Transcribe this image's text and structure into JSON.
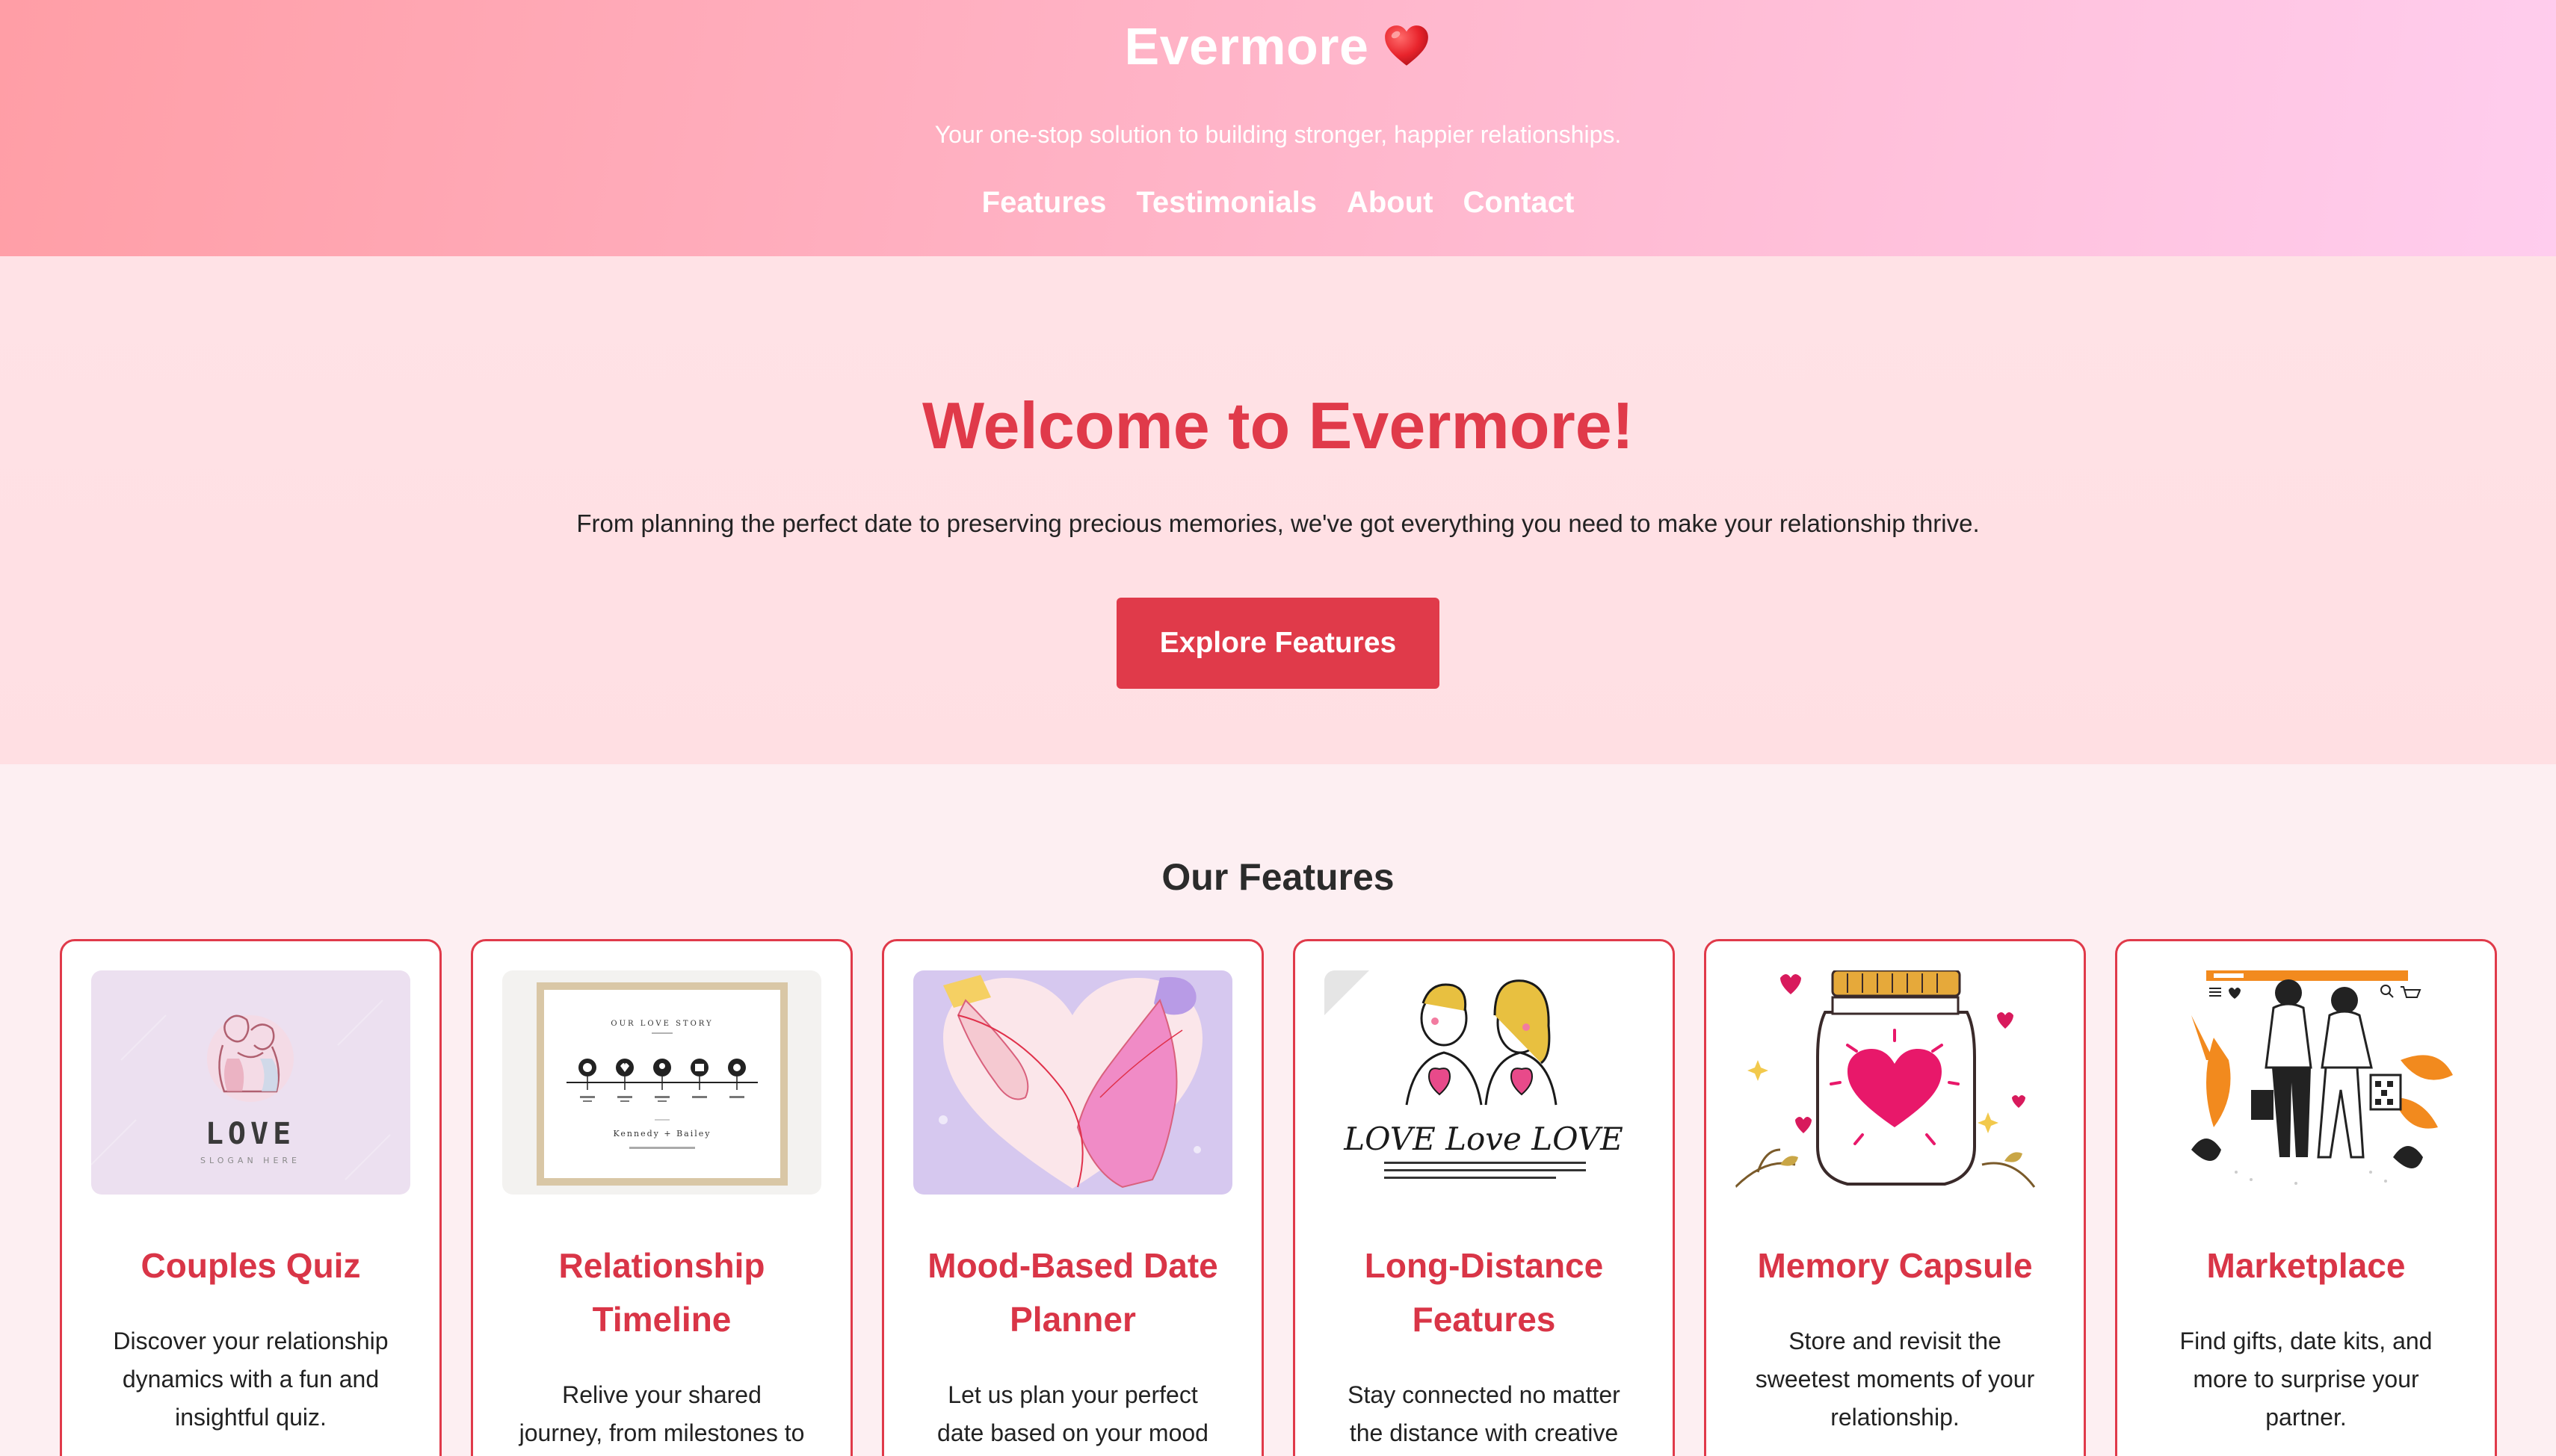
{
  "header": {
    "brand": "Evermore",
    "brand_emoji": "❤️",
    "tagline": "Your one-stop solution to building stronger, happier relationships.",
    "nav": [
      {
        "label": "Features"
      },
      {
        "label": "Testimonials"
      },
      {
        "label": "About"
      },
      {
        "label": "Contact"
      }
    ]
  },
  "hero": {
    "title": "Welcome to Evermore!",
    "text": "From planning the perfect date to preserving precious memories, we've got everything you need to make your relationship thrive.",
    "cta_label": "Explore Features"
  },
  "features": {
    "heading": "Our Features",
    "cards": [
      {
        "title": "Couples Quiz",
        "desc": "Discover your relationship dynamics with a fun and insightful quiz.",
        "image_text": "LOVE",
        "image_subtext": "SLOGAN HERE"
      },
      {
        "title": "Relationship Timeline",
        "desc": "Relive your shared journey, from milestones to cherished moments.",
        "image_text": "OUR LOVE STORY",
        "image_subtext": "Kennedy + Bailey"
      },
      {
        "title": "Mood-Based Date Planner",
        "desc": "Let us plan your perfect date based on your mood and preferences."
      },
      {
        "title": "Long-Distance Features",
        "desc": "Stay connected no matter the distance with creative tools.",
        "image_text": "LOVE Love LOVE"
      },
      {
        "title": "Memory Capsule",
        "desc": "Store and revisit the sweetest moments of your relationship."
      },
      {
        "title": "Marketplace",
        "desc": "Find gifts, date kits, and more to surprise your partner."
      }
    ]
  },
  "colors": {
    "accent": "#e03a4a",
    "header_gradient_start": "#ff9ea6",
    "header_gradient_end": "#ffcdee",
    "hero_bg": "#ffe0e4",
    "features_bg": "#fdeff2"
  }
}
